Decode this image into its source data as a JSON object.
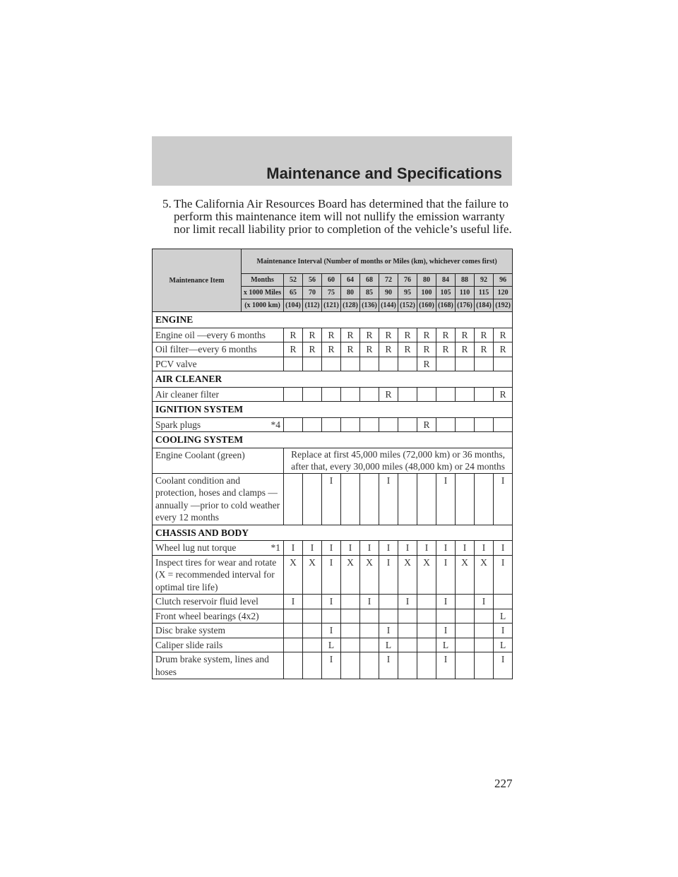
{
  "header": {
    "title": "Maintenance and Specifications"
  },
  "note": {
    "number": "5.",
    "text": "The California Air Resources Board has determined that the failure to perform this maintenance item will not nullify the emission warranty nor limit recall liability prior to completion of the vehicle’s useful life."
  },
  "table": {
    "item_header": "Maintenance Item",
    "interval_header": "Maintenance Interval (Number of months or Miles (km), whichever comes first)",
    "months_label": "Months",
    "months": [
      "52",
      "56",
      "60",
      "64",
      "68",
      "72",
      "76",
      "80",
      "84",
      "88",
      "92",
      "96"
    ],
    "miles_label": "x 1000 Miles",
    "miles": [
      "65",
      "70",
      "75",
      "80",
      "85",
      "90",
      "95",
      "100",
      "105",
      "110",
      "115",
      "120"
    ],
    "km_label": "(x 1000 km)",
    "km": [
      "(104)",
      "(112)",
      "(121)",
      "(128)",
      "(136)",
      "(144)",
      "(152)",
      "(160)",
      "(168)",
      "(176)",
      "(184)",
      "(192)"
    ],
    "rows": [
      {
        "section": "ENGINE"
      },
      {
        "label": "Engine oil —every 6 months",
        "marks": [
          "R",
          "R",
          "R",
          "R",
          "R",
          "R",
          "R",
          "R",
          "R",
          "R",
          "R",
          "R"
        ]
      },
      {
        "label": "Oil filter—every 6 months",
        "marks": [
          "R",
          "R",
          "R",
          "R",
          "R",
          "R",
          "R",
          "R",
          "R",
          "R",
          "R",
          "R"
        ]
      },
      {
        "label": "PCV valve",
        "marks": [
          "",
          "",
          "",
          "",
          "",
          "",
          "",
          "R",
          "",
          "",
          "",
          ""
        ]
      },
      {
        "section": "AIR CLEANER"
      },
      {
        "label": "Air cleaner filter",
        "marks": [
          "",
          "",
          "",
          "",
          "",
          "R",
          "",
          "",
          "",
          "",
          "",
          "R"
        ]
      },
      {
        "section": "IGNITION SYSTEM"
      },
      {
        "label": "Spark plugs",
        "footnote": "*4",
        "marks": [
          "",
          "",
          "",
          "",
          "",
          "",
          "",
          "R",
          "",
          "",
          "",
          ""
        ]
      },
      {
        "section": "COOLING SYSTEM"
      },
      {
        "label": "Engine Coolant (green)",
        "span_text": "Replace at first 45,000 miles (72,000 km) or 36 months, after that, every 30,000 miles (48,000 km) or 24 months"
      },
      {
        "label": "Coolant condition and protection, hoses and clamps — annually —prior to cold weather every 12 months",
        "marks": [
          "",
          "",
          "I",
          "",
          "",
          "I",
          "",
          "",
          "I",
          "",
          "",
          "I"
        ]
      },
      {
        "section": "CHASSIS AND BODY"
      },
      {
        "label": "Wheel lug nut torque",
        "footnote": "*1",
        "marks": [
          "I",
          "I",
          "I",
          "I",
          "I",
          "I",
          "I",
          "I",
          "I",
          "I",
          "I",
          "I"
        ]
      },
      {
        "label": "Inspect tires for wear and rotate (X = recommended interval for optimal tire life)",
        "marks": [
          "X",
          "X",
          "I",
          "X",
          "X",
          "I",
          "X",
          "X",
          "I",
          "X",
          "X",
          "I"
        ]
      },
      {
        "label": "Clutch reservoir fluid level",
        "marks": [
          "I",
          "",
          "I",
          "",
          "I",
          "",
          "I",
          "",
          "I",
          "",
          "I",
          ""
        ]
      },
      {
        "label": "Front wheel bearings (4x2)",
        "marks": [
          "",
          "",
          "",
          "",
          "",
          "",
          "",
          "",
          "",
          "",
          "",
          "L"
        ]
      },
      {
        "label": "Disc brake system",
        "marks": [
          "",
          "",
          "I",
          "",
          "",
          "I",
          "",
          "",
          "I",
          "",
          "",
          "I"
        ]
      },
      {
        "label": "Caliper slide rails",
        "marks": [
          "",
          "",
          "L",
          "",
          "",
          "L",
          "",
          "",
          "L",
          "",
          "",
          "L"
        ]
      },
      {
        "label": "Drum brake system, lines and hoses",
        "marks": [
          "",
          "",
          "I",
          "",
          "",
          "I",
          "",
          "",
          "I",
          "",
          "",
          "I"
        ]
      }
    ]
  },
  "page_number": "227"
}
